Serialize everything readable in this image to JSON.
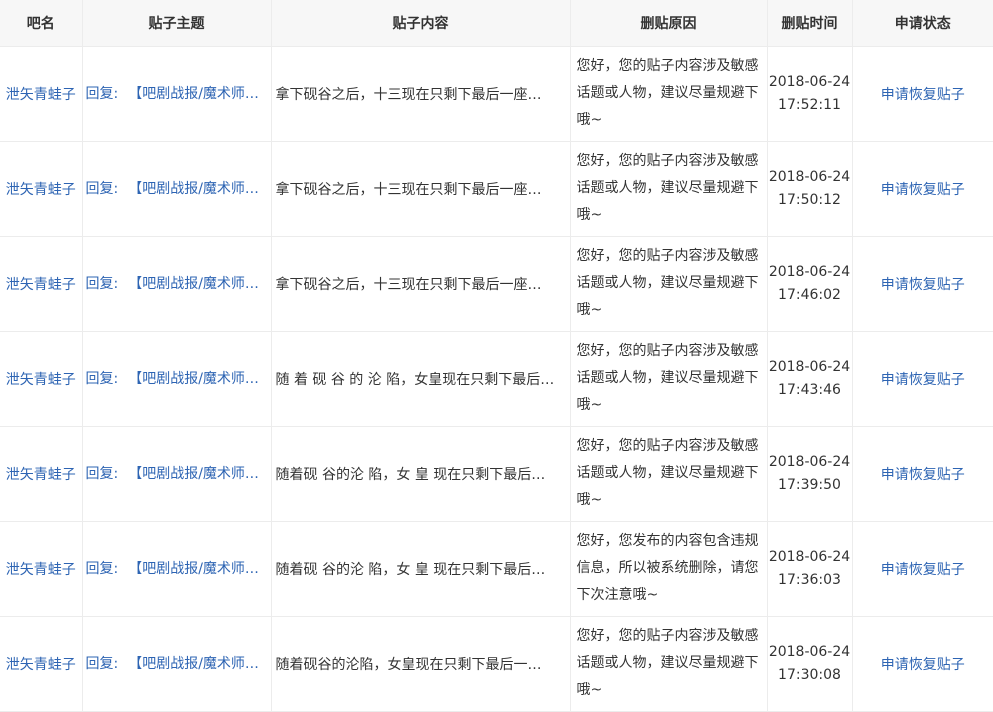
{
  "table": {
    "headers": [
      "吧名",
      "贴子主题",
      "贴子内容",
      "删贴原因",
      "删贴时间",
      "申请状态"
    ],
    "rows": [
      {
        "forum": "泄矢青蛙子",
        "topic_prefix": "回复:",
        "topic_title": "【吧剧战报/魔术师…",
        "content": "拿下砚谷之后，十三现在只剩下最后一座…",
        "reason": "您好，您的贴子内容涉及敏感话题或人物，建议尽量规避下哦~",
        "date": "2018-06-24",
        "time": "17:52:11",
        "status": "申请恢复贴子"
      },
      {
        "forum": "泄矢青蛙子",
        "topic_prefix": "回复:",
        "topic_title": "【吧剧战报/魔术师…",
        "content": "拿下砚谷之后，十三现在只剩下最后一座…",
        "reason": "您好，您的贴子内容涉及敏感话题或人物，建议尽量规避下哦~",
        "date": "2018-06-24",
        "time": "17:50:12",
        "status": "申请恢复贴子"
      },
      {
        "forum": "泄矢青蛙子",
        "topic_prefix": "回复:",
        "topic_title": "【吧剧战报/魔术师…",
        "content": "拿下砚谷之后，十三现在只剩下最后一座…",
        "reason": "您好，您的贴子内容涉及敏感话题或人物，建议尽量规避下哦~",
        "date": "2018-06-24",
        "time": "17:46:02",
        "status": "申请恢复贴子"
      },
      {
        "forum": "泄矢青蛙子",
        "topic_prefix": "回复:",
        "topic_title": "【吧剧战报/魔术师…",
        "content": "随 着 砚 谷 的 沦 陷，女皇现在只剩下最后…",
        "reason": "您好，您的贴子内容涉及敏感话题或人物，建议尽量规避下哦~",
        "date": "2018-06-24",
        "time": "17:43:46",
        "status": "申请恢复贴子"
      },
      {
        "forum": "泄矢青蛙子",
        "topic_prefix": "回复:",
        "topic_title": "【吧剧战报/魔术师…",
        "content": "随着砚 谷的沦 陷，女 皇 现在只剩下最后…",
        "reason": "您好，您的贴子内容涉及敏感话题或人物，建议尽量规避下哦~",
        "date": "2018-06-24",
        "time": "17:39:50",
        "status": "申请恢复贴子"
      },
      {
        "forum": "泄矢青蛙子",
        "topic_prefix": "回复:",
        "topic_title": "【吧剧战报/魔术师…",
        "content": "随着砚 谷的沦 陷，女 皇 现在只剩下最后…",
        "reason": "您好，您发布的内容包含违规信息，所以被系统删除，请您下次注意哦~",
        "date": "2018-06-24",
        "time": "17:36:03",
        "status": "申请恢复贴子"
      },
      {
        "forum": "泄矢青蛙子",
        "topic_prefix": "回复:",
        "topic_title": "【吧剧战报/魔术师…",
        "content": "随着砚谷的沦陷，女皇现在只剩下最后一…",
        "reason": "您好，您的贴子内容涉及敏感话题或人物，建议尽量规避下哦~",
        "date": "2018-06-24",
        "time": "17:30:08",
        "status": "申请恢复贴子"
      }
    ]
  },
  "colors": {
    "link": "#2d64b3",
    "header_bg": "#f7f7f7",
    "border": "#ececec",
    "text": "#333333"
  }
}
